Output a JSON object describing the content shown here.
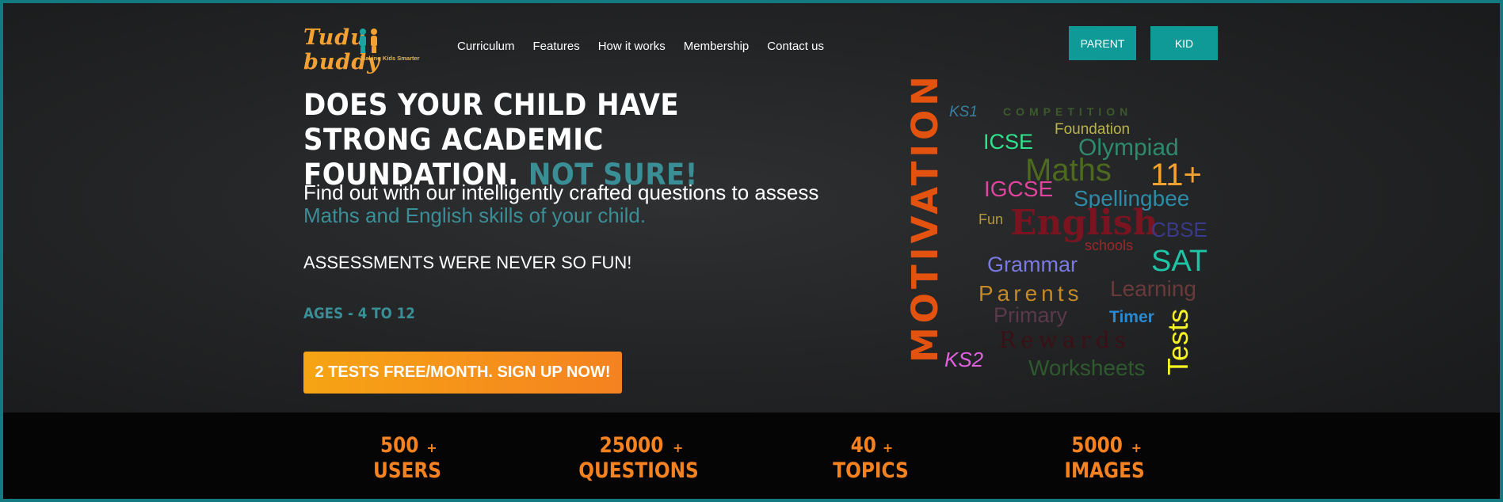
{
  "logo": {
    "text": "Tudu buddy",
    "tagline": "Making Kids Smarter"
  },
  "nav": [
    "Curriculum",
    "Features",
    "How it works",
    "Membership",
    "Contact us"
  ],
  "role_buttons": {
    "parent": "PARENT",
    "kid": "KID"
  },
  "hero": {
    "headline_line1": "DOES YOUR CHILD HAVE STRONG ACADEMIC",
    "headline_line2": "FOUNDATION.",
    "headline_accent": "NOT SURE!",
    "sub_line1": "Find out with our intelligently crafted questions to assess",
    "sub_line2": "Maths and English skills of your child.",
    "fun_line": "ASSESSMENTS WERE NEVER SO FUN!",
    "ages": "AGES - 4 TO 12",
    "cta": "2 TESTS FREE/MONTH. SIGN UP NOW!"
  },
  "word_cloud": {
    "vertical_word": "MOTIVATION",
    "vertical_right": "Tests",
    "words": [
      "KS1",
      "COMPETITION",
      "Foundation",
      "ICSE",
      "Olympiad",
      "Maths",
      "11+",
      "IGCSE",
      "Spellingbee",
      "Fun",
      "English",
      "CBSE",
      "schools",
      "Grammar",
      "SAT",
      "Parents",
      "Learning",
      "Primary",
      "Timer",
      "Rewards",
      "KS2",
      "Worksheets"
    ]
  },
  "stats": [
    {
      "num": "500",
      "plus": "+",
      "label": "USERS"
    },
    {
      "num": "25000",
      "plus": "+",
      "label": "QUESTIONS"
    },
    {
      "num": "40",
      "plus": "+",
      "label": "TOPICS"
    },
    {
      "num": "5000",
      "plus": "+",
      "label": "IMAGES"
    }
  ],
  "colors": {
    "accent_teal": "#3a8f96",
    "button_teal": "#0f9a97",
    "orange": "#f58220",
    "frame": "#127a80"
  }
}
